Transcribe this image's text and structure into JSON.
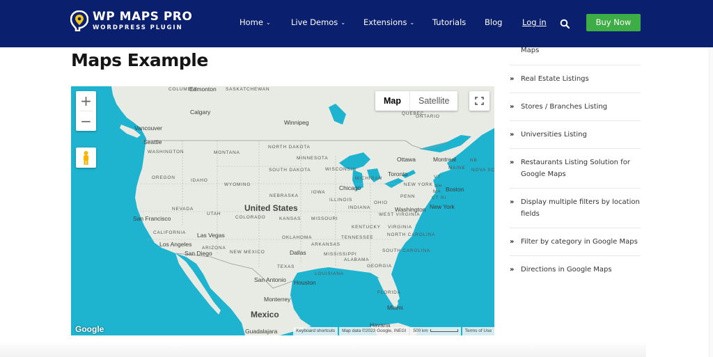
{
  "header": {
    "logo_title": "WP MAPS PRO",
    "logo_subtitle": "WORDPRESS PLUGIN",
    "nav": [
      {
        "label": "Home",
        "dropdown": true
      },
      {
        "label": "Live Demos",
        "dropdown": true
      },
      {
        "label": "Extensions",
        "dropdown": true
      },
      {
        "label": "Tutorials",
        "dropdown": false
      },
      {
        "label": "Blog",
        "dropdown": false
      },
      {
        "label": "Log in",
        "dropdown": false
      }
    ],
    "search_icon": "search-icon",
    "buy_label": "Buy Now",
    "colors": {
      "header_bg": "#0a1f6e",
      "buy_bg": "#3ead45",
      "logo_pin": "#f5c518"
    }
  },
  "page": {
    "title": "Maps Example"
  },
  "map": {
    "zoom_in": "+",
    "zoom_out": "−",
    "type_map": "Map",
    "type_satellite": "Satellite",
    "google_logo": "Google",
    "attribution": {
      "shortcuts": "Keyboard shortcuts",
      "data": "Map data ©2023 Google, INEGI",
      "scale": "500 km",
      "terms": "Terms of Use"
    },
    "colors": {
      "water": "#1eb3cf",
      "land": "#e8ebe4"
    },
    "country_labels": [
      "United States",
      "Mexico"
    ],
    "region_labels": [
      "COLUMBIA",
      "SASKATCHEWAN",
      "ONTARIO",
      "QUEBEC",
      "WASHINGTON",
      "MONTANA",
      "NORTH DAKOTA",
      "MINNESOTA",
      "OREGON",
      "IDAHO",
      "SOUTH DAKOTA",
      "WISCONSIN",
      "MICHIGAN",
      "WYOMING",
      "NEBRASKA",
      "IOWA",
      "ILLINOIS",
      "NEVADA",
      "UTAH",
      "COLORADO",
      "KANSAS",
      "MISSOURI",
      "INDIANA",
      "OHIO",
      "PENN",
      "NEW YORK",
      "CALIFORNIA",
      "ARIZONA",
      "NEW MEXICO",
      "OKLAHOMA",
      "ARKANSAS",
      "TENNESSEE",
      "KENTUCKY",
      "WEST VIRGINIA",
      "VIRGINIA",
      "NORTH CAROLINA",
      "SOUTH CAROLINA",
      "MISSISSIPPI",
      "ALABAMA",
      "GEORGIA",
      "LOUISIANA",
      "TEXAS",
      "FLORIDA",
      "MAINE",
      "VT",
      "NH",
      "MA",
      "CT",
      "RI",
      "NB",
      "NOVA SCOTIA"
    ],
    "city_labels": [
      "Edmonton",
      "Calgary",
      "Vancouver",
      "Seattle",
      "Winnipeg",
      "Ottawa",
      "Montreal",
      "Toronto",
      "Chicago",
      "Boston",
      "New York",
      "Washington",
      "San Francisco",
      "Las Vegas",
      "Los Angeles",
      "San Diego",
      "Dallas",
      "San Antonio",
      "Houston",
      "Monterrey",
      "Miami",
      "Havana",
      "Guadalajara"
    ]
  },
  "sidebar": {
    "items": [
      {
        "label": "Maps",
        "arrow": false
      },
      {
        "label": "Real Estate Listings",
        "arrow": true
      },
      {
        "label": "Stores / Branches Listing",
        "arrow": true
      },
      {
        "label": "Universities Listing",
        "arrow": true
      },
      {
        "label": "Restaurants Listing Solution for Google Maps",
        "arrow": true
      },
      {
        "label": "Display multiple filters by location fields",
        "arrow": true
      },
      {
        "label": "Filter by category in Google Maps",
        "arrow": true
      },
      {
        "label": "Directions in Google Maps",
        "arrow": true
      }
    ]
  }
}
